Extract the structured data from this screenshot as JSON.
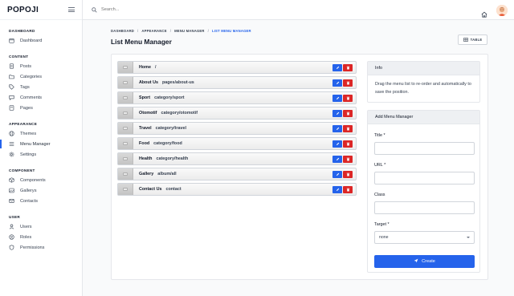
{
  "app": {
    "logo": "POPOJI"
  },
  "search": {
    "placeholder": "Search..."
  },
  "sidebar": {
    "sections": [
      {
        "title": "DASHBOARD",
        "items": [
          {
            "label": "Dashboard",
            "icon": "calendar-icon"
          }
        ]
      },
      {
        "title": "CONTENT",
        "items": [
          {
            "label": "Posts",
            "icon": "file-icon"
          },
          {
            "label": "Categories",
            "icon": "folder-icon"
          },
          {
            "label": "Tags",
            "icon": "tag-icon"
          },
          {
            "label": "Comments",
            "icon": "comment-icon"
          },
          {
            "label": "Pages",
            "icon": "page-icon"
          }
        ]
      },
      {
        "title": "APPEARANCE",
        "items": [
          {
            "label": "Themes",
            "icon": "globe-icon"
          },
          {
            "label": "Menu Manager",
            "icon": "list-icon",
            "active": true
          },
          {
            "label": "Settings",
            "icon": "gear-icon"
          }
        ]
      },
      {
        "title": "COMPONENT",
        "items": [
          {
            "label": "Components",
            "icon": "box-icon"
          },
          {
            "label": "Gallerys",
            "icon": "image-icon"
          },
          {
            "label": "Contacts",
            "icon": "mail-icon"
          }
        ]
      },
      {
        "title": "USER",
        "items": [
          {
            "label": "Users",
            "icon": "user-icon"
          },
          {
            "label": "Roles",
            "icon": "roles-icon"
          },
          {
            "label": "Permissions",
            "icon": "shield-icon"
          }
        ]
      }
    ]
  },
  "breadcrumb": [
    "DASHBOARD",
    "APPEARANCE",
    "MENU MANAGER",
    "LIST MENU MANAGER"
  ],
  "page": {
    "title": "List Menu Manager",
    "table_button": "TABLE"
  },
  "menu_items": [
    {
      "title": "Home",
      "url": "/"
    },
    {
      "title": "About Us",
      "url": "pages/about-us"
    },
    {
      "title": "Sport",
      "url": "category/sport"
    },
    {
      "title": "Otomotif",
      "url": "category/otomotif"
    },
    {
      "title": "Travel",
      "url": "category/travel"
    },
    {
      "title": "Food",
      "url": "category/food"
    },
    {
      "title": "Health",
      "url": "category/health"
    },
    {
      "title": "Gallery",
      "url": "album/all"
    },
    {
      "title": "Contact Us",
      "url": "contact"
    }
  ],
  "info": {
    "title": "Info",
    "text": "Drag the menu list to re-order and automatically to save the position."
  },
  "form": {
    "title": "Add Menu Manager",
    "title_label": "Title *",
    "url_label": "URL *",
    "class_label": "Class",
    "target_label": "Target *",
    "target_value": "none",
    "create_label": "Create"
  },
  "colors": {
    "accent": "#2563eb",
    "danger": "#dc2626"
  }
}
